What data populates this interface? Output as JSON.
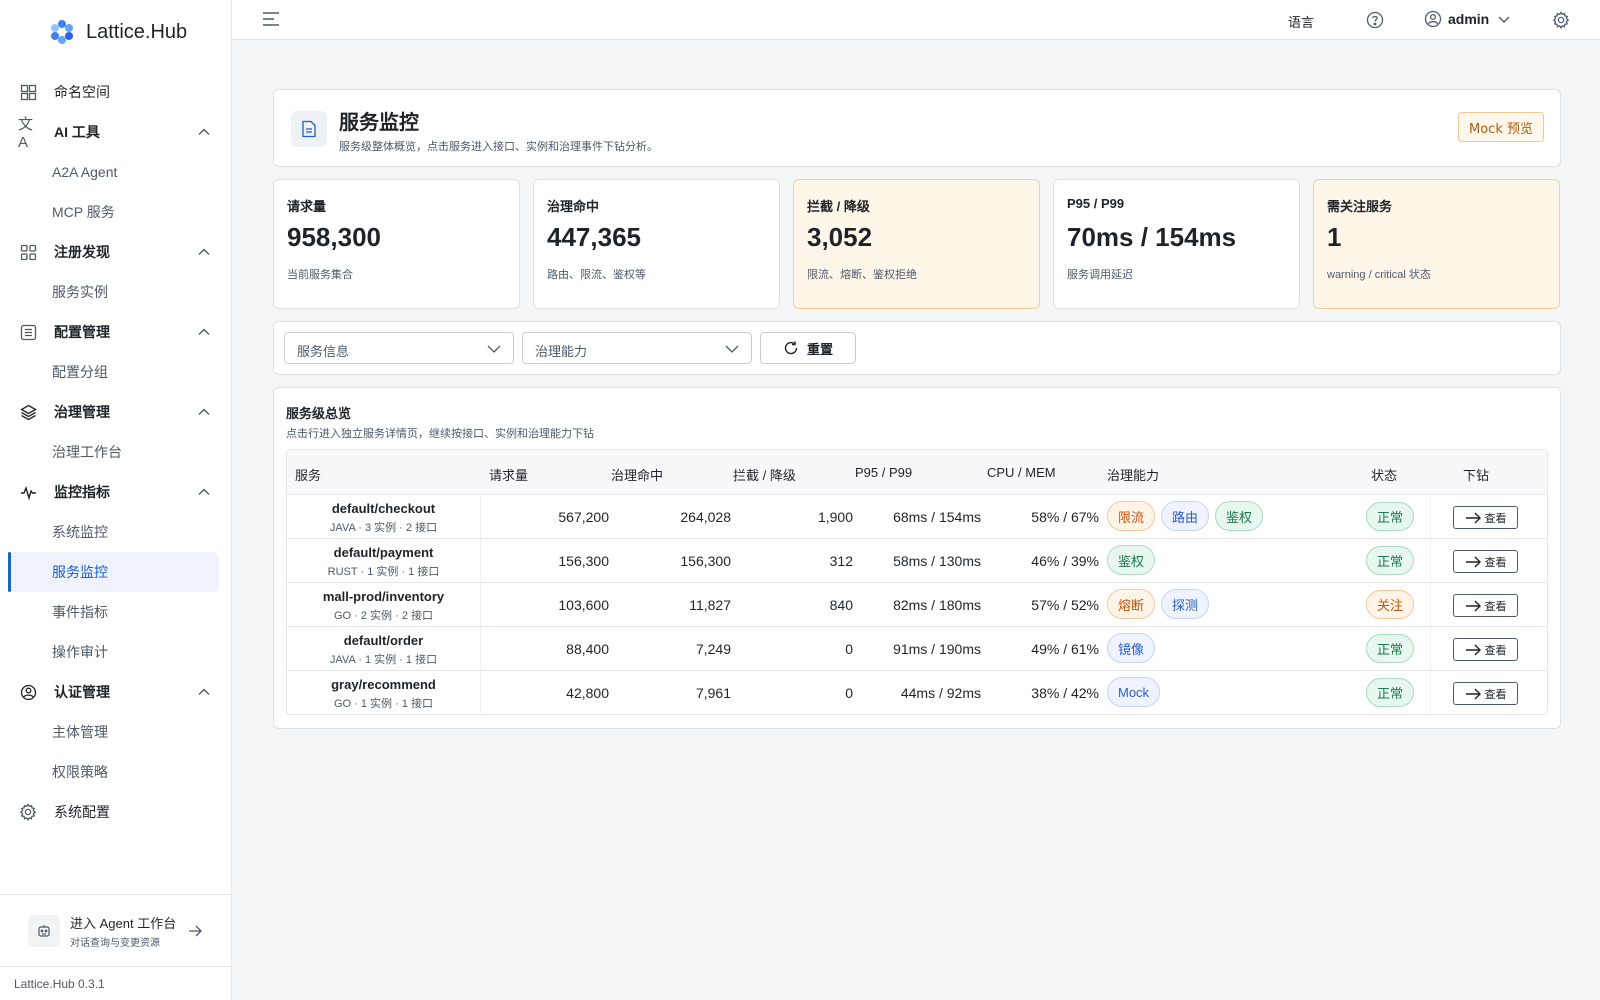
{
  "app": {
    "name": "Lattice.Hub",
    "version": "Lattice.Hub 0.3.1"
  },
  "sidebar": {
    "items": [
      {
        "label": "命名空间",
        "icon": "namespace-icon",
        "type": "item"
      },
      {
        "label": "AI 工具",
        "icon": "ai-tools-icon",
        "type": "group"
      },
      {
        "label": "A2A Agent",
        "type": "sub"
      },
      {
        "label": "MCP 服务",
        "type": "sub"
      },
      {
        "label": "注册发现",
        "icon": "grid-icon",
        "type": "group"
      },
      {
        "label": "服务实例",
        "type": "sub"
      },
      {
        "label": "配置管理",
        "icon": "list-icon",
        "type": "group"
      },
      {
        "label": "配置分组",
        "type": "sub"
      },
      {
        "label": "治理管理",
        "icon": "layers-icon",
        "type": "group"
      },
      {
        "label": "治理工作台",
        "type": "sub"
      },
      {
        "label": "监控指标",
        "icon": "pulse-icon",
        "type": "group"
      },
      {
        "label": "系统监控",
        "type": "sub"
      },
      {
        "label": "服务监控",
        "type": "sub",
        "active": true
      },
      {
        "label": "事件指标",
        "type": "sub"
      },
      {
        "label": "操作审计",
        "type": "sub"
      },
      {
        "label": "认证管理",
        "icon": "user-circle-icon",
        "type": "group"
      },
      {
        "label": "主体管理",
        "type": "sub"
      },
      {
        "label": "权限策略",
        "type": "sub"
      },
      {
        "label": "系统配置",
        "icon": "gear-icon",
        "type": "item"
      }
    ],
    "agent": {
      "title": "进入 Agent 工作台",
      "subtitle": "对话查询与变更资源"
    }
  },
  "topbar": {
    "language": "语言",
    "user": "admin"
  },
  "page": {
    "title": "服务监控",
    "description": "服务级整体概览，点击服务进入接口、实例和治理事件下钻分析。",
    "mock_button": "Mock 预览"
  },
  "stats": [
    {
      "label": "请求量",
      "value": "958,300",
      "sub": "当前服务集合",
      "warn": false
    },
    {
      "label": "治理命中",
      "value": "447,365",
      "sub": "路由、限流、鉴权等",
      "warn": false
    },
    {
      "label": "拦截 / 降级",
      "value": "3,052",
      "sub": "限流、熔断、鉴权拒绝",
      "warn": true
    },
    {
      "label": "P95 / P99",
      "value": "70ms / 154ms",
      "sub": "服务调用延迟",
      "warn": false
    },
    {
      "label": "需关注服务",
      "value": "1",
      "sub": "warning / critical 状态",
      "warn": true
    }
  ],
  "filters": {
    "service_info": "服务信息",
    "governance": "治理能力",
    "reset": "重置"
  },
  "table": {
    "title": "服务级总览",
    "description": "点击行进入独立服务详情页，继续按接口、实例和治理能力下钻",
    "columns": [
      "服务",
      "请求量",
      "治理命中",
      "拦截 / 降级",
      "P95 / P99",
      "CPU / MEM",
      "治理能力",
      "状态",
      "下钻"
    ],
    "rows": [
      {
        "name": "default/checkout",
        "meta": "JAVA · 3 实例 · 2 接口",
        "requests": "567,200",
        "hits": "264,028",
        "blocked": "1,900",
        "latency": "68ms / 154ms",
        "cpu_mem": "58% / 67%",
        "tags": [
          {
            "label": "限流",
            "color": "orange"
          },
          {
            "label": "路由",
            "color": "blue"
          },
          {
            "label": "鉴权",
            "color": "green"
          }
        ],
        "status": "正常",
        "status_type": "ok",
        "action": "查看"
      },
      {
        "name": "default/payment",
        "meta": "RUST · 1 实例 · 1 接口",
        "requests": "156,300",
        "hits": "156,300",
        "blocked": "312",
        "latency": "58ms / 130ms",
        "cpu_mem": "46% / 39%",
        "tags": [
          {
            "label": "鉴权",
            "color": "green"
          }
        ],
        "status": "正常",
        "status_type": "ok",
        "action": "查看"
      },
      {
        "name": "mall-prod/inventory",
        "meta": "GO · 2 实例 · 2 接口",
        "requests": "103,600",
        "hits": "11,827",
        "blocked": "840",
        "latency": "82ms / 180ms",
        "cpu_mem": "57% / 52%",
        "tags": [
          {
            "label": "熔断",
            "color": "orange"
          },
          {
            "label": "探测",
            "color": "blue"
          }
        ],
        "status": "关注",
        "status_type": "warn",
        "action": "查看"
      },
      {
        "name": "default/order",
        "meta": "JAVA · 1 实例 · 1 接口",
        "requests": "88,400",
        "hits": "7,249",
        "blocked": "0",
        "latency": "91ms / 190ms",
        "cpu_mem": "49% / 61%",
        "tags": [
          {
            "label": "镜像",
            "color": "blue"
          }
        ],
        "status": "正常",
        "status_type": "ok",
        "action": "查看"
      },
      {
        "name": "gray/recommend",
        "meta": "GO · 1 实例 · 1 接口",
        "requests": "42,800",
        "hits": "7,961",
        "blocked": "0",
        "latency": "44ms / 92ms",
        "cpu_mem": "38% / 42%",
        "tags": [
          {
            "label": "Mock",
            "color": "blue"
          }
        ],
        "status": "正常",
        "status_type": "ok",
        "action": "查看"
      }
    ]
  },
  "colors": {
    "accent": "#1f5fc8",
    "warn_bg": "#fff6ea",
    "ok_green": "#1a7a4c",
    "warn_orange": "#c7540a"
  }
}
